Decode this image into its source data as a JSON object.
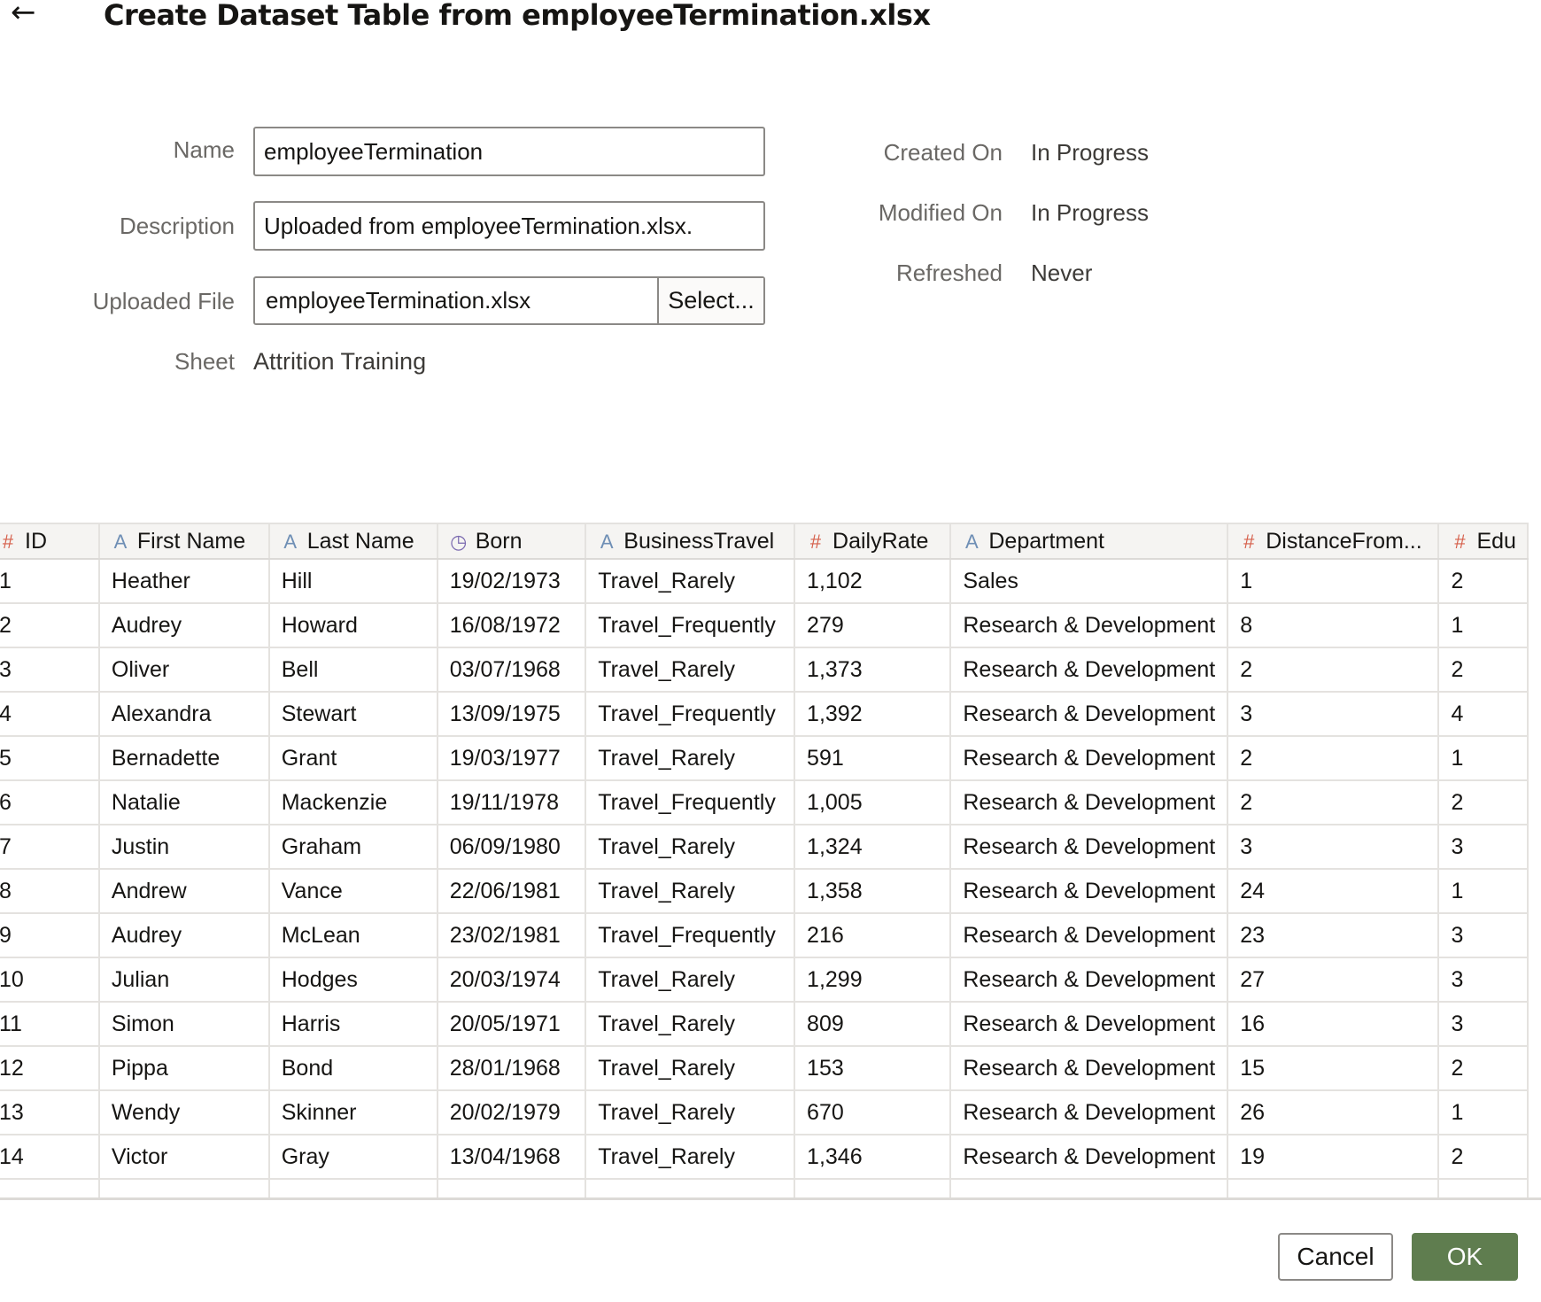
{
  "header": {
    "back_icon": "←",
    "title": "Create Dataset Table from employeeTermination.xlsx"
  },
  "form": {
    "name_label": "Name",
    "name_value": "employeeTermination",
    "description_label": "Description",
    "description_value": "Uploaded from employeeTermination.xlsx.",
    "file_label": "Uploaded File",
    "file_value": "employeeTermination.xlsx",
    "select_label": "Select...",
    "sheet_label": "Sheet",
    "sheet_value": "Attrition Training"
  },
  "meta": {
    "created_label": "Created On",
    "created_value": "In Progress",
    "modified_label": "Modified On",
    "modified_value": "In Progress",
    "refreshed_label": "Refreshed",
    "refreshed_value": "Never"
  },
  "grid": {
    "columns": [
      {
        "label": "ID",
        "type": "number",
        "icon": "#"
      },
      {
        "label": "First Name",
        "type": "text",
        "icon": "A"
      },
      {
        "label": "Last Name",
        "type": "text",
        "icon": "A"
      },
      {
        "label": "Born",
        "type": "date",
        "icon": "◷"
      },
      {
        "label": "BusinessTravel",
        "type": "text",
        "icon": "A"
      },
      {
        "label": "DailyRate",
        "type": "number",
        "icon": "#"
      },
      {
        "label": "Department",
        "type": "text",
        "icon": "A"
      },
      {
        "label": "DistanceFrom...",
        "type": "number",
        "icon": "#"
      },
      {
        "label": "Edu",
        "type": "number",
        "icon": "#"
      }
    ],
    "rows": [
      [
        "1",
        "Heather",
        "Hill",
        "19/02/1973",
        "Travel_Rarely",
        "1,102",
        "Sales",
        "1",
        "2"
      ],
      [
        "2",
        "Audrey",
        "Howard",
        "16/08/1972",
        "Travel_Frequently",
        "279",
        "Research & Development",
        "8",
        "1"
      ],
      [
        "3",
        "Oliver",
        "Bell",
        "03/07/1968",
        "Travel_Rarely",
        "1,373",
        "Research & Development",
        "2",
        "2"
      ],
      [
        "4",
        "Alexandra",
        "Stewart",
        "13/09/1975",
        "Travel_Frequently",
        "1,392",
        "Research & Development",
        "3",
        "4"
      ],
      [
        "5",
        "Bernadette",
        "Grant",
        "19/03/1977",
        "Travel_Rarely",
        "591",
        "Research & Development",
        "2",
        "1"
      ],
      [
        "6",
        "Natalie",
        "Mackenzie",
        "19/11/1978",
        "Travel_Frequently",
        "1,005",
        "Research & Development",
        "2",
        "2"
      ],
      [
        "7",
        "Justin",
        "Graham",
        "06/09/1980",
        "Travel_Rarely",
        "1,324",
        "Research & Development",
        "3",
        "3"
      ],
      [
        "8",
        "Andrew",
        "Vance",
        "22/06/1981",
        "Travel_Rarely",
        "1,358",
        "Research & Development",
        "24",
        "1"
      ],
      [
        "9",
        "Audrey",
        "McLean",
        "23/02/1981",
        "Travel_Frequently",
        "216",
        "Research & Development",
        "23",
        "3"
      ],
      [
        "10",
        "Julian",
        "Hodges",
        "20/03/1974",
        "Travel_Rarely",
        "1,299",
        "Research & Development",
        "27",
        "3"
      ],
      [
        "11",
        "Simon",
        "Harris",
        "20/05/1971",
        "Travel_Rarely",
        "809",
        "Research & Development",
        "16",
        "3"
      ],
      [
        "12",
        "Pippa",
        "Bond",
        "28/01/1968",
        "Travel_Rarely",
        "153",
        "Research & Development",
        "15",
        "2"
      ],
      [
        "13",
        "Wendy",
        "Skinner",
        "20/02/1979",
        "Travel_Rarely",
        "670",
        "Research & Development",
        "26",
        "1"
      ],
      [
        "14",
        "Victor",
        "Gray",
        "13/04/1968",
        "Travel_Rarely",
        "1,346",
        "Research & Development",
        "19",
        "2"
      ],
      [
        "",
        "",
        "",
        "",
        "",
        "",
        "",
        "",
        ""
      ]
    ]
  },
  "buttons": {
    "cancel": "Cancel",
    "ok": "OK"
  },
  "colors": {
    "ok_button": "#5f7d4f",
    "number_icon": "#d65f4b",
    "text_icon": "#6f8fb5",
    "date_icon": "#7c6bb0"
  }
}
